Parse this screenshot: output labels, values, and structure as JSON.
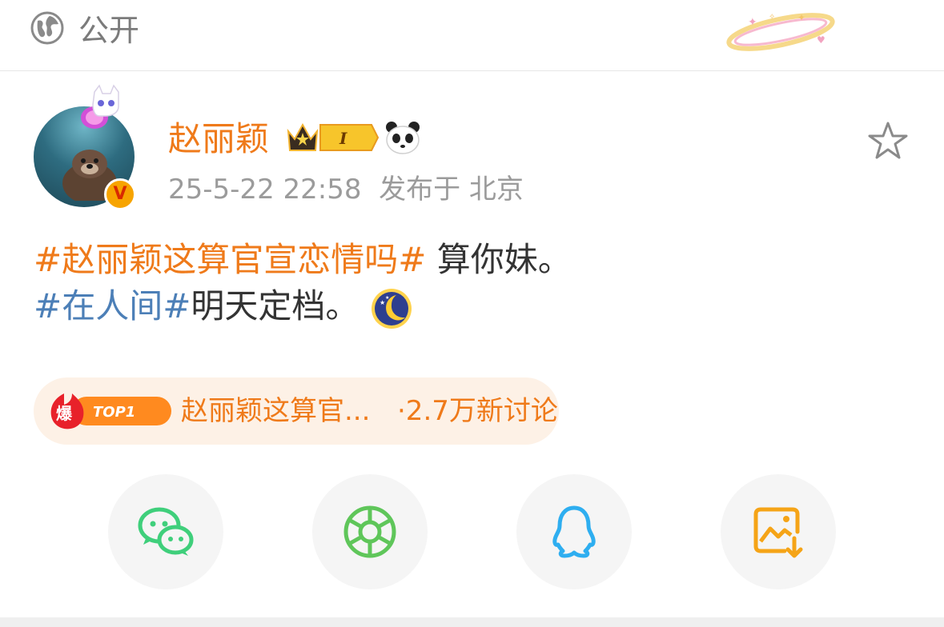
{
  "visibility": {
    "label": "公开",
    "icon": "globe-icon"
  },
  "post": {
    "author": "赵丽颖",
    "timestamp": "25-5-22 22:58",
    "location": "发布于 北京",
    "lines": [
      {
        "tag": "#赵丽颖这算官宣恋情吗#",
        "text": " 算你妹。"
      },
      {
        "tag": "#在人间#",
        "text": "明天定档。"
      }
    ]
  },
  "hot_topic": {
    "badge_char": "爆",
    "badge_rank": "TOP1",
    "title": "赵丽颖这算官...",
    "count": "·2.7万新讨论"
  },
  "share": [
    {
      "name": "wechat-icon",
      "color": "#3fcf7b"
    },
    {
      "name": "moments-icon",
      "color": "#5fc65a"
    },
    {
      "name": "qq-icon",
      "color": "#2eaef0"
    },
    {
      "name": "save-image-icon",
      "color": "#f5a417"
    }
  ],
  "colors": {
    "accent": "#ef7a1a",
    "link": "#4c7fb7",
    "text": "#333333",
    "meta": "#9b9b9b"
  }
}
